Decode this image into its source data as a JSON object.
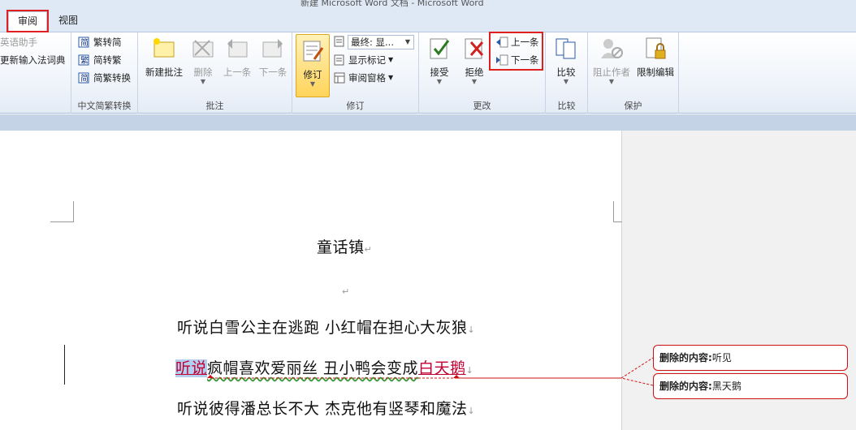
{
  "window": {
    "title": "新建 Microsoft Word 文档 - Microsoft Word"
  },
  "tabs": [
    {
      "label": "审阅",
      "active": true
    },
    {
      "label": "视图",
      "active": false
    }
  ],
  "ribbon": {
    "proofing": {
      "items": [
        "英语助手",
        "更新输入法词典"
      ]
    },
    "chinese": {
      "items": [
        "繁转简",
        "简转繁",
        "简繁转换"
      ],
      "label": "中文简繁转换"
    },
    "comments": {
      "new": "新建批注",
      "delete": "删除",
      "prev": "上一条",
      "next": "下一条",
      "label": "批注"
    },
    "tracking": {
      "track": "修订",
      "display_for_review": "最终: 显...",
      "show_markup": "显示标记",
      "reviewing_pane": "审阅窗格",
      "label": "修订"
    },
    "changes": {
      "accept": "接受",
      "reject": "拒绝",
      "prev": "上一条",
      "next": "下一条",
      "label": "更改"
    },
    "compare": {
      "compare": "比较",
      "label": "比较"
    },
    "protect": {
      "block_authors": "阻止作者",
      "restrict_editing": "限制编辑",
      "label": "保护"
    }
  },
  "document": {
    "title": "童话镇",
    "line1": "听说白雪公主在逃跑  小红帽在担心大灰狼",
    "line2_deleted_a": "听说",
    "line2_middle": "疯帽喜欢爱丽丝  丑小鸭会变成",
    "line2_deleted_b": "白天鹅",
    "line3": "听说彼得潘总长不大  杰克他有竖琴和魔法",
    "para_mark": "↵",
    "line_mark": "↓"
  },
  "balloons": [
    {
      "label": "删除的内容:",
      "text": "听见"
    },
    {
      "label": "删除的内容:",
      "text": "黑天鹅"
    }
  ],
  "colors": {
    "highlight_box": "#e02020",
    "deletion": "#c00030",
    "ribbon_bg": "#eef3fa"
  }
}
